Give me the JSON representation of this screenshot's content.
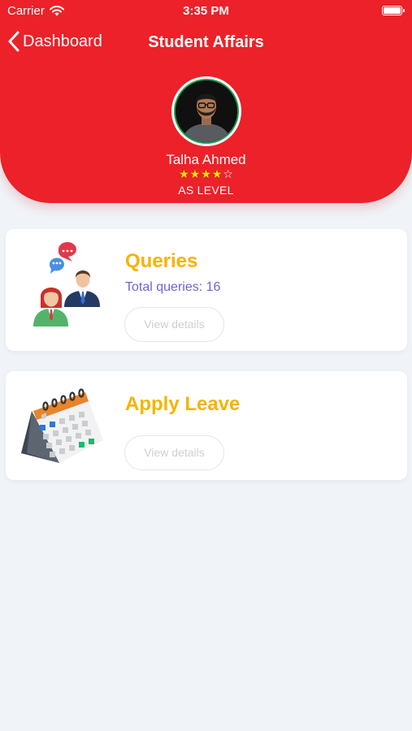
{
  "status_bar": {
    "carrier": "Carrier",
    "time": "3:35 PM"
  },
  "nav": {
    "back_label": "Dashboard",
    "title": "Student Affairs"
  },
  "profile": {
    "name": "Talha Ahmed",
    "rating": 4,
    "rating_max": 5,
    "level": "AS LEVEL"
  },
  "cards": {
    "queries": {
      "title": "Queries",
      "subtitle": "Total queries: 16",
      "button_label": "View details",
      "icon": "people-chat-icon"
    },
    "leave": {
      "title": "Apply Leave",
      "button_label": "View details",
      "icon": "calendar-icon"
    }
  },
  "colors": {
    "header": "#ec2129",
    "card_title": "#f5b400",
    "subtitle": "#6d63d6",
    "background": "#f0f3f7"
  }
}
